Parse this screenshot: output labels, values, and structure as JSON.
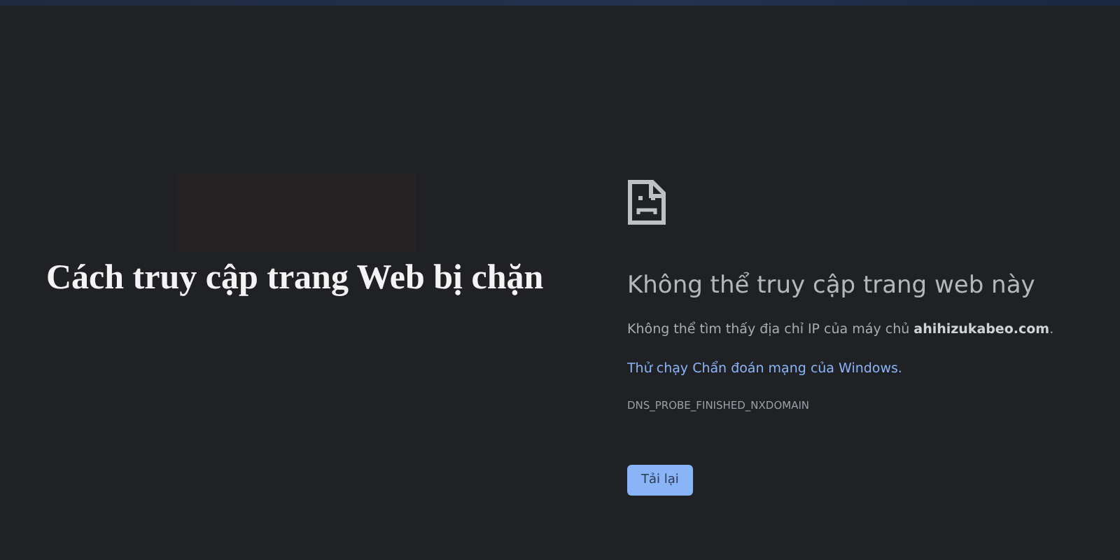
{
  "headline": "Cách truy cập trang Web bị chặn",
  "error_page": {
    "heading": "Không thể truy cập trang web này",
    "message": "Không thể tìm thấy địa chỉ IP của máy chủ **ahihizukabeo.com**.",
    "link": "Thử chạy Chẩn đoán mạng của Windows.",
    "error_code": "DNS_PROBE_FINISHED_NXDOMAIN",
    "buttons": [
      "Tải lại"
    ]
  }
}
